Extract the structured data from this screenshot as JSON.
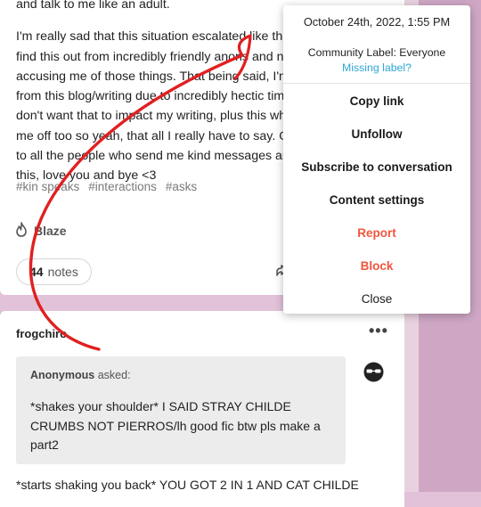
{
  "post1": {
    "text_line1": "and talk to me like an adult.",
    "paragraph_lines": [
      "I'm really sad that this situation escalated like that",
      "find this out from incredibly friendly anons and no",
      "accusing me of those things. That being said, I'm t",
      "from this blog/writing due to incredibly hectic tim",
      "don't want that to impact my writing, plus this who",
      "me off too so yeah, that all I really have to say. Onc",
      "to all the people who send me kind messages and",
      "this, love you and bye <3"
    ],
    "tags": [
      "#kin speaks",
      "#interactions",
      "#asks"
    ],
    "blaze_label": "Blaze",
    "notes_count": "44",
    "notes_label": "notes"
  },
  "post2": {
    "blog_name": "frogchiro",
    "more_label": "•••",
    "asker": "Anonymous",
    "asked_label": " asked:",
    "ask_text": "*shakes your shoulder* I SAID STRAY CHILDE CRUMBS NOT PIERROS/lh good fic btw pls make a part2",
    "answer_text": "*starts shaking you back* YOU GOT 2 IN 1 AND CAT CHILDE"
  },
  "menu": {
    "date": "October 24th, 2022, 1:55 PM",
    "community_label": "Community Label: Everyone",
    "missing_label": "Missing label?",
    "items": {
      "copy_link": "Copy link",
      "unfollow": "Unfollow",
      "subscribe": "Subscribe to conversation",
      "content_settings": "Content settings",
      "report": "Report",
      "block": "Block",
      "close": "Close"
    }
  },
  "colors": {
    "background": "#e2c2d8",
    "accent_link": "#2fa7d6",
    "danger": "#f2553c",
    "scribble": "#e02020"
  },
  "icons": [
    "flame-icon",
    "share-icon",
    "anonymous-avatar-icon",
    "more-dots-icon"
  ]
}
